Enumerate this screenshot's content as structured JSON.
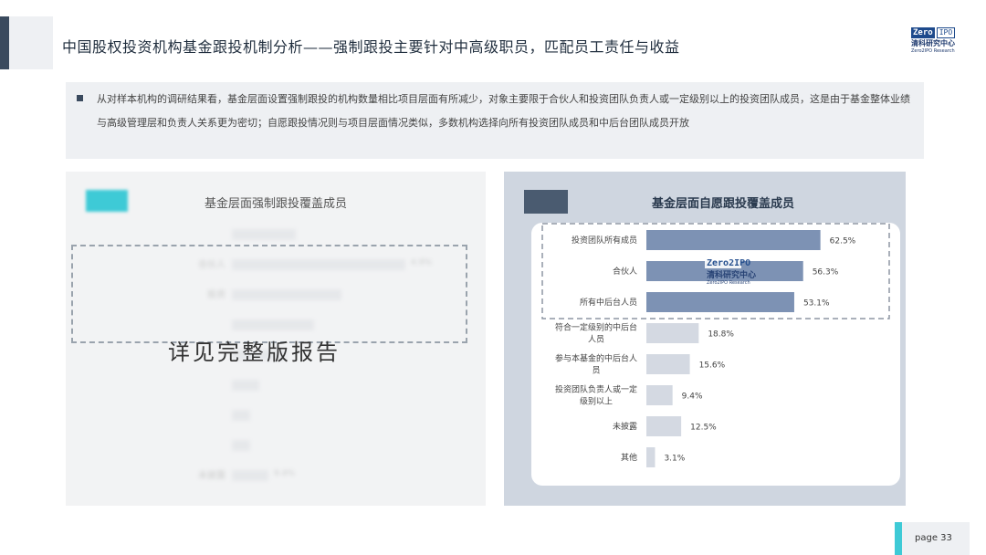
{
  "header": {
    "title": "中国股权投资机构基金跟投机制分析——强制跟投主要针对中高级职员，匹配员工责任与收益",
    "logo": {
      "zero": "Zero",
      "two": "2",
      "ipo": "IPO",
      "cn": "清科研究中心",
      "en": "Zero2IPO Research"
    }
  },
  "summary": {
    "text": "从对样本机构的调研结果看，基金层面设置强制跟投的机构数量相比项目层面有所减少，对象主要限于合伙人和投资团队负责人或一定级别以上的投资团队成员，这是由于基金整体业绩与高级管理层和负责人关系更为密切；自愿跟投情况则与项目层面情况类似，多数机构选择向所有投资团队成员和中后台团队成员开放"
  },
  "left_panel": {
    "title": "基金层面强制跟投覆盖成员",
    "watermark": "详见完整版报告",
    "blurred_rows": [
      {
        "label": "",
        "value": ""
      },
      {
        "label": "合伙人",
        "value": "4.9%"
      },
      {
        "label": "投资",
        "value": ""
      },
      {
        "label": "",
        "value": ""
      },
      {
        "label": "",
        "value": ""
      },
      {
        "label": "",
        "value": ""
      },
      {
        "label": "",
        "value": ""
      },
      {
        "label": "",
        "value": ""
      },
      {
        "label": "未披露",
        "value": "9.4%"
      }
    ]
  },
  "chart_data": {
    "type": "bar",
    "orientation": "horizontal",
    "title": "基金层面自愿跟投覆盖成员",
    "categories": [
      "投资团队所有成员",
      "合伙人",
      "所有中后台人员",
      "符合一定级别的中后台人员",
      "参与本基金的中后台人员",
      "投资团队负责人或一定级别以上",
      "未披露",
      "其他"
    ],
    "category_lines": [
      [
        "投资团队所有成员"
      ],
      [
        "合伙人"
      ],
      [
        "所有中后台人员"
      ],
      [
        "符合一定级别的中后台",
        "人员"
      ],
      [
        "参与本基金的中后台人",
        "员"
      ],
      [
        "投资团队负责人或一定",
        "级别以上"
      ],
      [
        "未披露"
      ],
      [
        "其他"
      ]
    ],
    "values": [
      62.5,
      56.3,
      53.1,
      18.8,
      15.6,
      9.4,
      12.5,
      3.1
    ],
    "value_labels": [
      "62.5%",
      "56.3%",
      "53.1%",
      "18.8%",
      "15.6%",
      "9.4%",
      "12.5%",
      "3.1%"
    ],
    "highlight_count": 3,
    "colors": {
      "highlight": "#7d92b4",
      "normal": "#d4d9e2"
    }
  },
  "footer": {
    "page": "page 33"
  }
}
